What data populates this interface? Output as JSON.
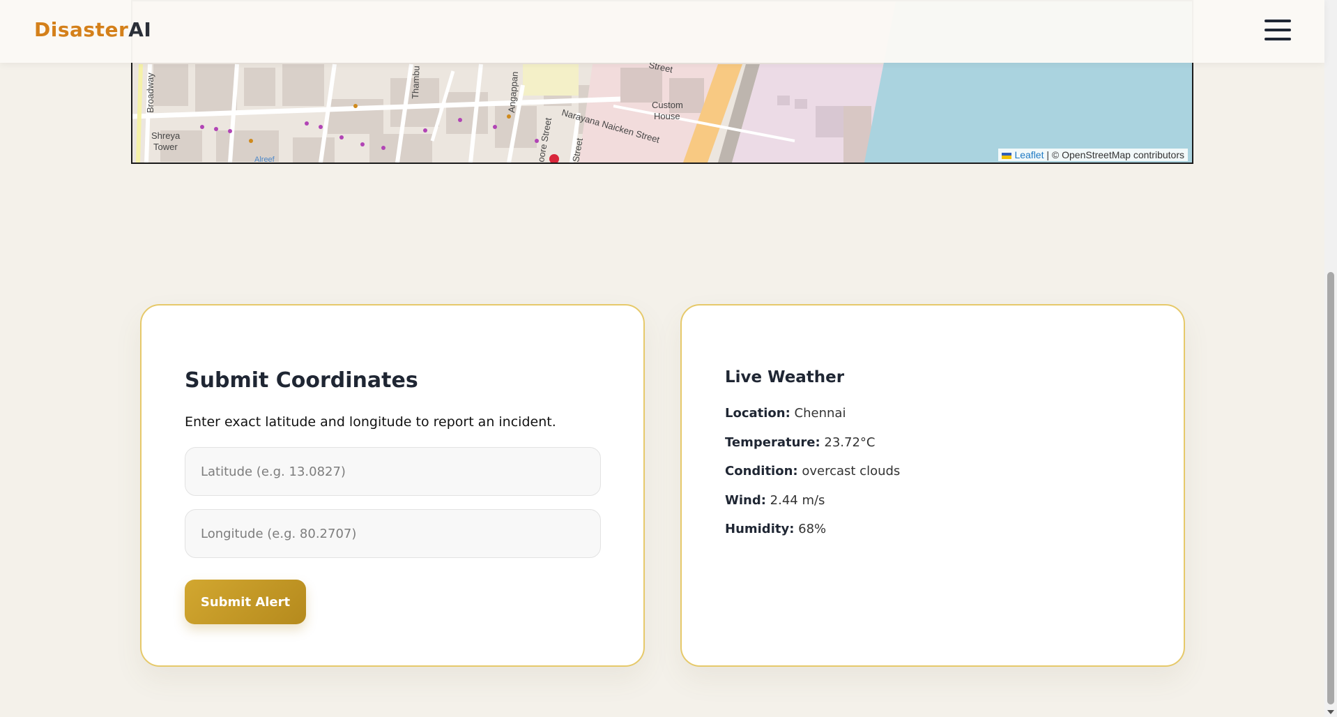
{
  "header": {
    "brand_part1": "Disaster",
    "brand_part2": "AI"
  },
  "map": {
    "labels": [
      "Broadway",
      "Shreya",
      "Tower",
      "Thambu",
      "Angappan",
      "Narayana Naicken Street",
      "Custom",
      "House",
      "Street",
      "oore Street",
      "Street",
      "Alreef"
    ],
    "attribution_link": "Leaflet",
    "attribution_text": "| © OpenStreetMap contributors"
  },
  "form": {
    "title": "Submit Coordinates",
    "description": "Enter exact latitude and longitude to report an incident.",
    "latitude_placeholder": "Latitude (e.g. 13.0827)",
    "longitude_placeholder": "Longitude (e.g. 80.2707)",
    "submit_label": "Submit Alert"
  },
  "weather": {
    "title": "Live Weather",
    "location_label": "Location:",
    "location_value": "Chennai",
    "temperature_label": "Temperature:",
    "temperature_value": "23.72°C",
    "condition_label": "Condition:",
    "condition_value": "overcast clouds",
    "wind_label": "Wind:",
    "wind_value": "2.44 m/s",
    "humidity_label": "Humidity:",
    "humidity_value": "68%"
  },
  "colors": {
    "brand_orange": "#d4801a",
    "accent_gold": "#c99a24",
    "card_border": "#e6c96a",
    "water": "#aad3df"
  }
}
